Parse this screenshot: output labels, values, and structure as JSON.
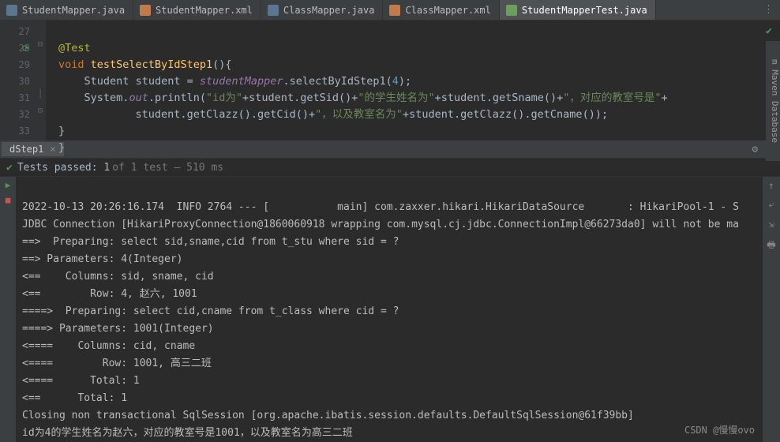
{
  "tabs": [
    {
      "label": "StudentMapper.java",
      "icon": "java"
    },
    {
      "label": "StudentMapper.xml",
      "icon": "xml"
    },
    {
      "label": "ClassMapper.java",
      "icon": "java"
    },
    {
      "label": "ClassMapper.xml",
      "icon": "xml"
    },
    {
      "label": "StudentMapperTest.java",
      "icon": "test",
      "active": true
    }
  ],
  "right_dots": "⋮",
  "right_side": {
    "maven": "m Maven",
    "db": "Database"
  },
  "gutter": {
    "l27": "27",
    "l28": "28",
    "l29": "29",
    "l30": "30",
    "l31": "31",
    "l32": "32",
    "l33": "33"
  },
  "code": {
    "ann": "@Test",
    "kw_void": "void",
    "fn": "testSelectByIdStep1",
    "brace_open": "(){",
    "ty_student": "Student",
    "var_student": "student",
    "eq": " = ",
    "fld_mapper": "studentMapper",
    "dot": ".",
    "m_sel": "selectByIdStep1",
    "arg4": "4",
    "semi": ";",
    "sys": "System",
    "out": "out",
    "println": "println",
    "s1": "\"id为\"",
    "plus": "+",
    "m_sid": "getSid",
    "s2": "\"的学生姓名为\"",
    "m_sname": "getSname",
    "s3": "\"，对应的教室号是\"",
    "m_clazz": "getClazz",
    "m_cid": "getCid",
    "s4": "\"，以及教室名为\"",
    "m_cname": "getCname",
    "brace_close": "}",
    "brace_close2": "}"
  },
  "run": {
    "tab": "dStep1",
    "close": "×",
    "gear": "⚙",
    "minus": "—"
  },
  "status": {
    "check": "✔",
    "text": "Tests passed: 1",
    "of": " of 1 test – 510 ms"
  },
  "console": {
    "l1": "2022-10-13 20:26:16.174  INFO 2764 --- [           main] com.zaxxer.hikari.HikariDataSource       : HikariPool-1 - S",
    "l2": "JDBC Connection [HikariProxyConnection@1860060918 wrapping com.mysql.cj.jdbc.ConnectionImpl@66273da0] will not be ma",
    "l3": "==>  Preparing: select sid,sname,cid from t_stu where sid = ?",
    "l4": "==> Parameters: 4(Integer)",
    "l5": "<==    Columns: sid, sname, cid",
    "l6": "<==        Row: 4, 赵六, 1001",
    "l7": "====>  Preparing: select cid,cname from t_class where cid = ?",
    "l8": "====> Parameters: 1001(Integer)",
    "l9": "<====    Columns: cid, cname",
    "l10": "<====        Row: 1001, 高三二班",
    "l11": "<====      Total: 1",
    "l12": "<==      Total: 1",
    "l13": "Closing non transactional SqlSession [org.apache.ibatis.session.defaults.DefaultSqlSession@61f39bb]",
    "l14": "id为4的学生姓名为赵六，对应的教室号是1001，以及教室名为高三二班"
  },
  "side": {
    "play": "▶",
    "stop": "■"
  },
  "rside": {
    "up": "↑",
    "wrap": "⤶",
    "scroll": "⇲",
    "print": "🖶"
  },
  "watermark": "CSDN @慢慢ovo"
}
